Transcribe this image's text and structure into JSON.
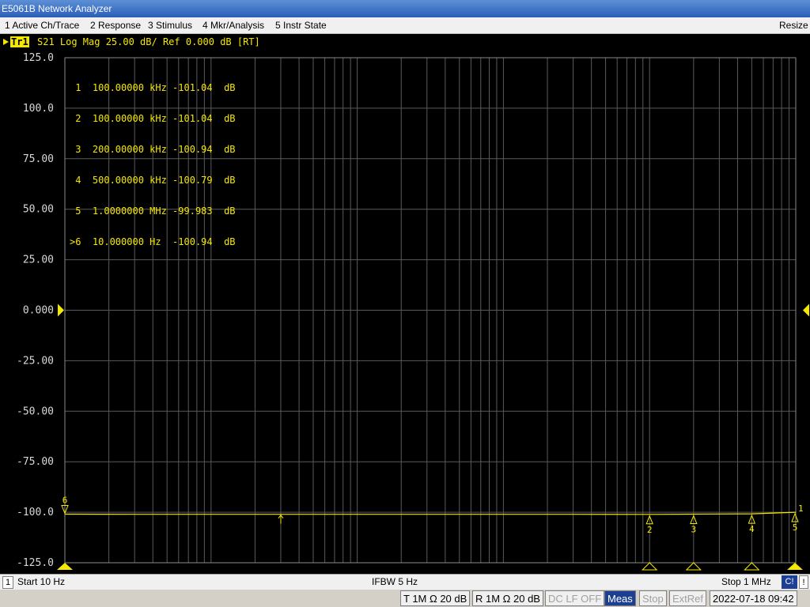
{
  "window": {
    "title": "E5061B Network Analyzer"
  },
  "menu": {
    "items": [
      "1 Active Ch/Trace",
      "2 Response",
      "3 Stimulus",
      "4 Mkr/Analysis",
      "5 Instr State"
    ],
    "resize": "Resize"
  },
  "trace": {
    "badge": "Tr1",
    "label": "S21 Log Mag 25.00 dB/ Ref 0.000 dB [RT]"
  },
  "markers": {
    "table": [
      " 1  100.00000 kHz -101.04  dB",
      " 2  100.00000 kHz -101.04  dB",
      " 3  200.00000 kHz -100.94  dB",
      " 4  500.00000 kHz -100.79  dB",
      " 5  1.0000000 MHz -99.983  dB",
      ">6  10.000000 Hz  -100.94  dB"
    ]
  },
  "chart_data": {
    "type": "line",
    "title": "S21 Log Mag 25.00 dB/ Ref 0.000 dB [RT]",
    "x_scale": "log",
    "xlim": [
      10,
      1000000
    ],
    "ylim": [
      -125,
      125
    ],
    "yticks": [
      125,
      100,
      75,
      50,
      25,
      0,
      -25,
      -50,
      -75,
      -100,
      -125
    ],
    "ytick_labels": [
      "125.0",
      "100.0",
      "75.00",
      "50.00",
      "25.00",
      "0.000",
      "-25.00",
      "-50.00",
      "-75.00",
      "-100.0",
      "-125.0"
    ],
    "reference_level": 0,
    "series": [
      {
        "color": "#f5e800",
        "x": [
          10,
          30,
          100,
          300,
          1000,
          3000,
          10000,
          30000,
          100000,
          200000,
          500000,
          1000000
        ],
        "y": [
          -100.94,
          -101.0,
          -101.0,
          -101.0,
          -101.0,
          -101.0,
          -101.0,
          -101.0,
          -101.04,
          -100.94,
          -100.79,
          -99.983
        ]
      }
    ],
    "markers": [
      {
        "label": "1",
        "x": 1000000,
        "y": -99.983
      },
      {
        "label": "2",
        "x": 100000,
        "y": -101.04
      },
      {
        "label": "3",
        "x": 200000,
        "y": -100.94
      },
      {
        "label": "4",
        "x": 500000,
        "y": -100.79
      },
      {
        "label": "5",
        "x": 1000000,
        "y": -99.983
      },
      {
        "label": "6",
        "x": 10,
        "y": -100.94
      }
    ],
    "grid": true
  },
  "status": {
    "channel": "1",
    "start": "Start 10 Hz",
    "ifbw": "IFBW 5 Hz",
    "stop": "Stop 1 MHz",
    "cal": "C!",
    "warn": "!"
  },
  "status2": {
    "t_input": "T 1M Ω 20 dB",
    "r_input": "R 1M Ω 20 dB",
    "dclf": "DC LF OFF",
    "meas": "Meas",
    "stop": "Stop",
    "extref": "ExtRef",
    "datetime": "2022-07-18 09:42"
  }
}
